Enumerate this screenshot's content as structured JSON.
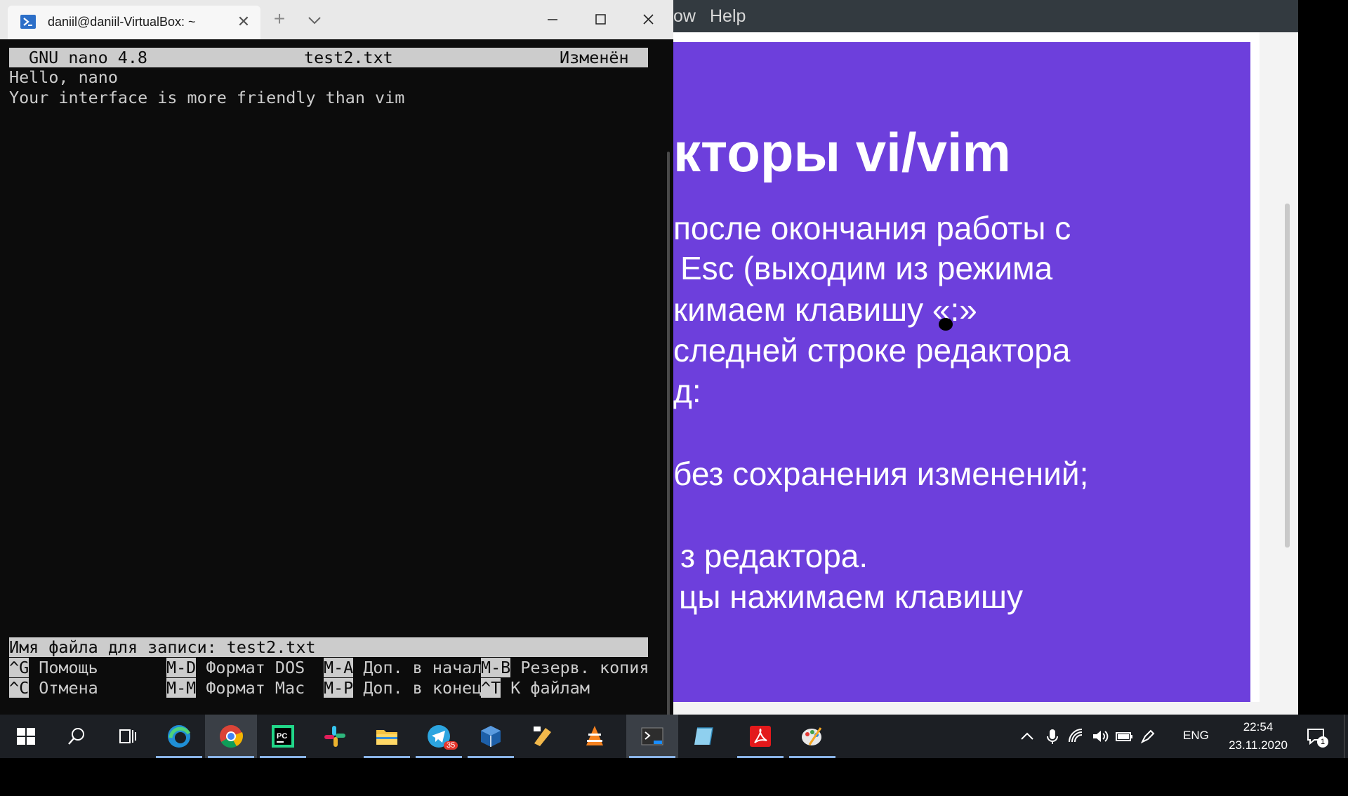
{
  "terminal": {
    "tab_title": "daniil@daniil-VirtualBox: ~",
    "tab_close": "✕",
    "new_tab": "+",
    "nano": {
      "header_app": "GNU nano 4.8",
      "header_file": "test2.txt",
      "header_status": "Изменён",
      "lines": [
        "Hello, nano",
        "Your interface is more friendly than vim"
      ],
      "prompt": "Имя файла для записи: test2.txt",
      "shortcuts_row1": [
        {
          "key": "^G",
          "label": " Помощь"
        },
        {
          "key": "M-D",
          "label": " Формат DOS"
        },
        {
          "key": "M-A",
          "label": " Доп. в начал"
        },
        {
          "key": "M-B",
          "label": " Резерв. копия"
        }
      ],
      "shortcuts_row2": [
        {
          "key": "^C",
          "label": " Отмена"
        },
        {
          "key": "M-M",
          "label": " Формат Mac"
        },
        {
          "key": "M-P",
          "label": " Доп. в конец"
        },
        {
          "key": "^T",
          "label": " К файлам"
        }
      ]
    }
  },
  "video": {
    "menu": {
      "window": "ow",
      "help": "Help"
    },
    "slide": {
      "title": "кторы vi/vim",
      "lines": [
        " после окончания работы с",
        "Esc (выходим из режима",
        "кимаем клавишу «:»",
        "следней строке редактора",
        "д:",
        "без сохранения изменений;",
        "з редактора.",
        "цы нажимаем клавишу"
      ],
      "bg_color": "#6d3fdc"
    }
  },
  "taskbar": {
    "apps": [
      "start-icon",
      "search-icon",
      "task-view-icon",
      "edge-icon",
      "chrome-icon",
      "pycharm-icon",
      "slack-icon",
      "file-explorer-icon",
      "telegram-icon",
      "virtualbox-icon",
      "app-icon",
      "vlc-icon",
      "terminal-icon",
      "notepad-icon",
      "acrobat-icon",
      "paint-icon"
    ],
    "telegram_badge": "35",
    "language": "ENG",
    "time": "22:54",
    "date": "23.11.2020",
    "notification_count": "1"
  }
}
